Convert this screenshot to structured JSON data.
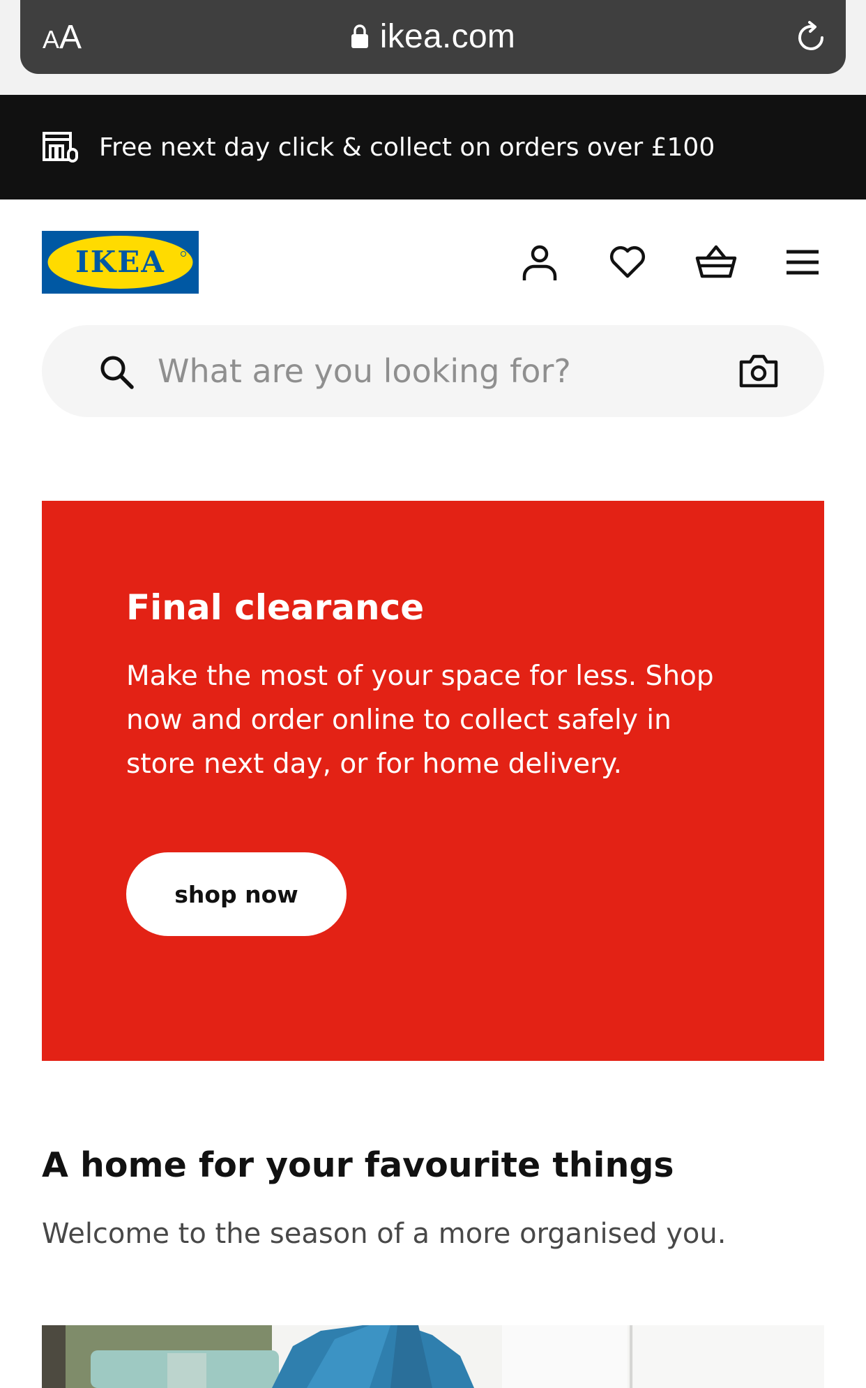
{
  "browser": {
    "text_size_small": "A",
    "text_size_large": "A",
    "url": "ikea.com"
  },
  "promo": {
    "text": "Free next day click & collect on orders over £100"
  },
  "header": {
    "logo_text": "IKEA"
  },
  "search": {
    "placeholder": "What are you looking for?"
  },
  "hero": {
    "title": "Final clearance",
    "body": "Make the most of your space for less. Shop now and order online to collect safely in store next day, or for home delivery.",
    "button_label": "shop now",
    "background_color": "#e32215"
  },
  "section": {
    "title": "A home for your favourite things",
    "subtitle": "Welcome to the season of a more organised you."
  },
  "colors": {
    "brand_blue": "#0058a3",
    "brand_yellow": "#ffdb00",
    "promo_bar": "#111111",
    "search_bg": "#f5f5f5"
  }
}
